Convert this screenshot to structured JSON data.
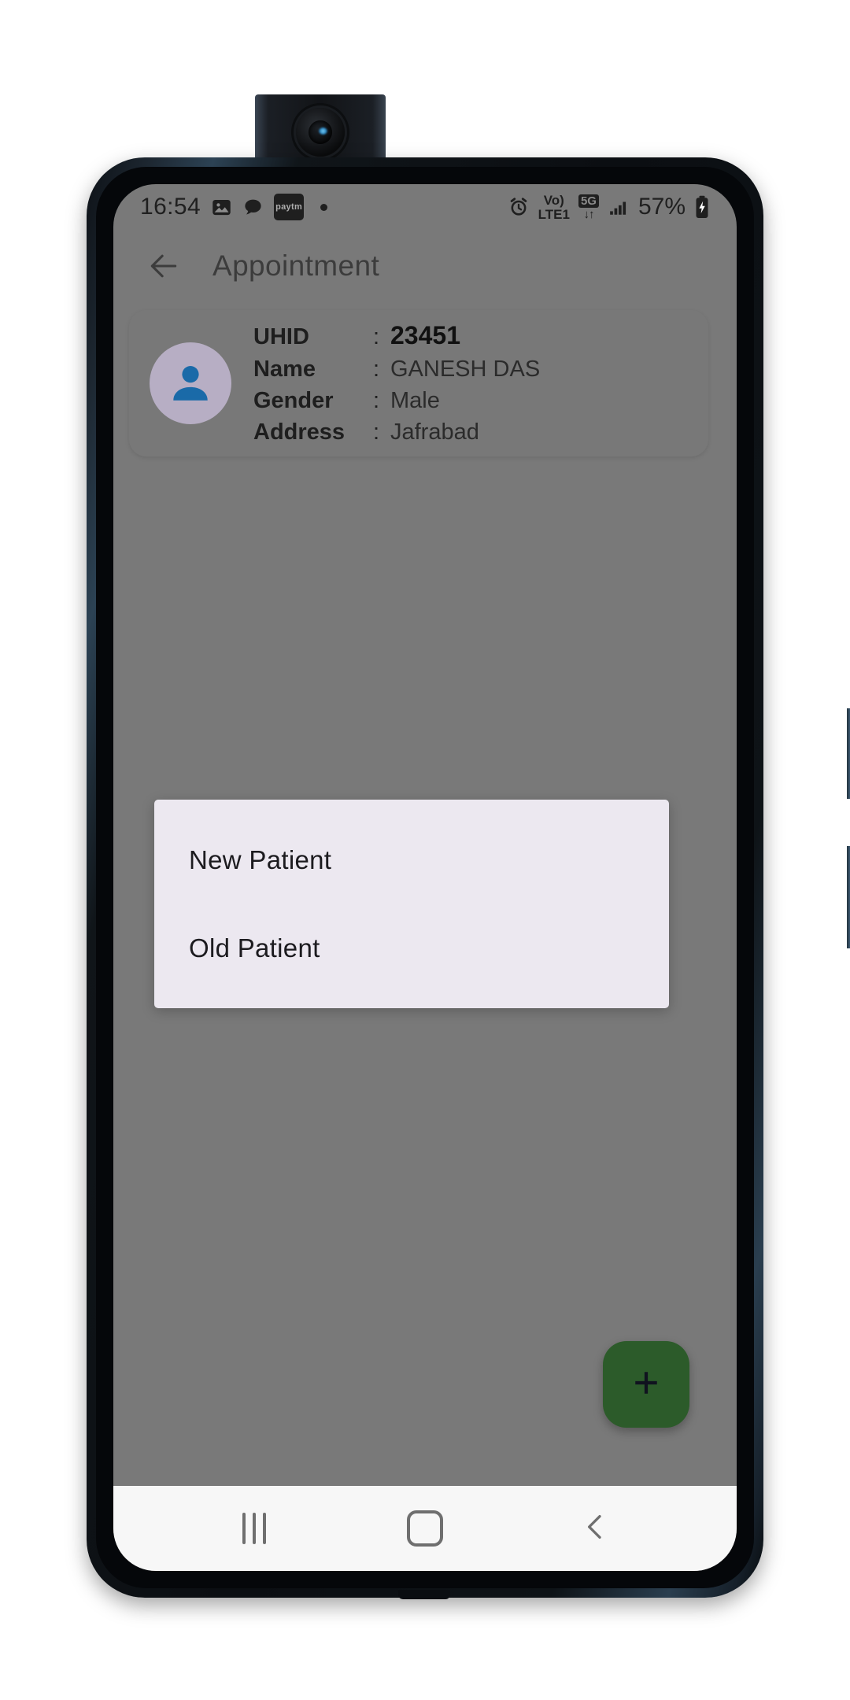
{
  "device": {
    "camera_module": "popup-front-camera"
  },
  "status_bar": {
    "clock": "16:54",
    "left_icons": [
      "photos-icon",
      "messages-icon",
      "paytm-icon",
      "notification-dot-icon"
    ],
    "paytm_label": "paytm",
    "alarm_icon": "alarm-clock-icon",
    "volte_top": "Vo)",
    "volte_bottom": "LTE1",
    "network_label": "5G",
    "network_arrows": "↓↑",
    "signal_icon": "signal-bars-icon",
    "battery_percent": "57%",
    "battery_icon": "battery-charging-icon"
  },
  "app_bar": {
    "back_icon": "back-arrow-icon",
    "title": "Appointment"
  },
  "patient_card": {
    "avatar_icon": "person-avatar-icon",
    "fields": [
      {
        "label": "UHID",
        "colon": ":",
        "value": "23451",
        "emphasis": true
      },
      {
        "label": "Name",
        "colon": ":",
        "value": "GANESH DAS",
        "emphasis": false
      },
      {
        "label": "Gender",
        "colon": ":",
        "value": "Male",
        "emphasis": false
      },
      {
        "label": "Address",
        "colon": ":",
        "value": "Jafrabad",
        "emphasis": false
      }
    ]
  },
  "dialog": {
    "option_new": "New Patient",
    "option_old": "Old Patient",
    "background_color": "#ece8f0"
  },
  "fab": {
    "icon": "plus-icon",
    "color": "#2c5b2a"
  },
  "nav_bar": {
    "recents_label": "recents-button",
    "home_label": "home-button",
    "back_label": "back-button"
  },
  "colors": {
    "scrim": "#797979",
    "card": "rgba(120,120,120,0.62)",
    "avatar_bg": "#b7aec4",
    "avatar_fg": "#1a6aa8",
    "accent_green": "#2c5b2a"
  }
}
